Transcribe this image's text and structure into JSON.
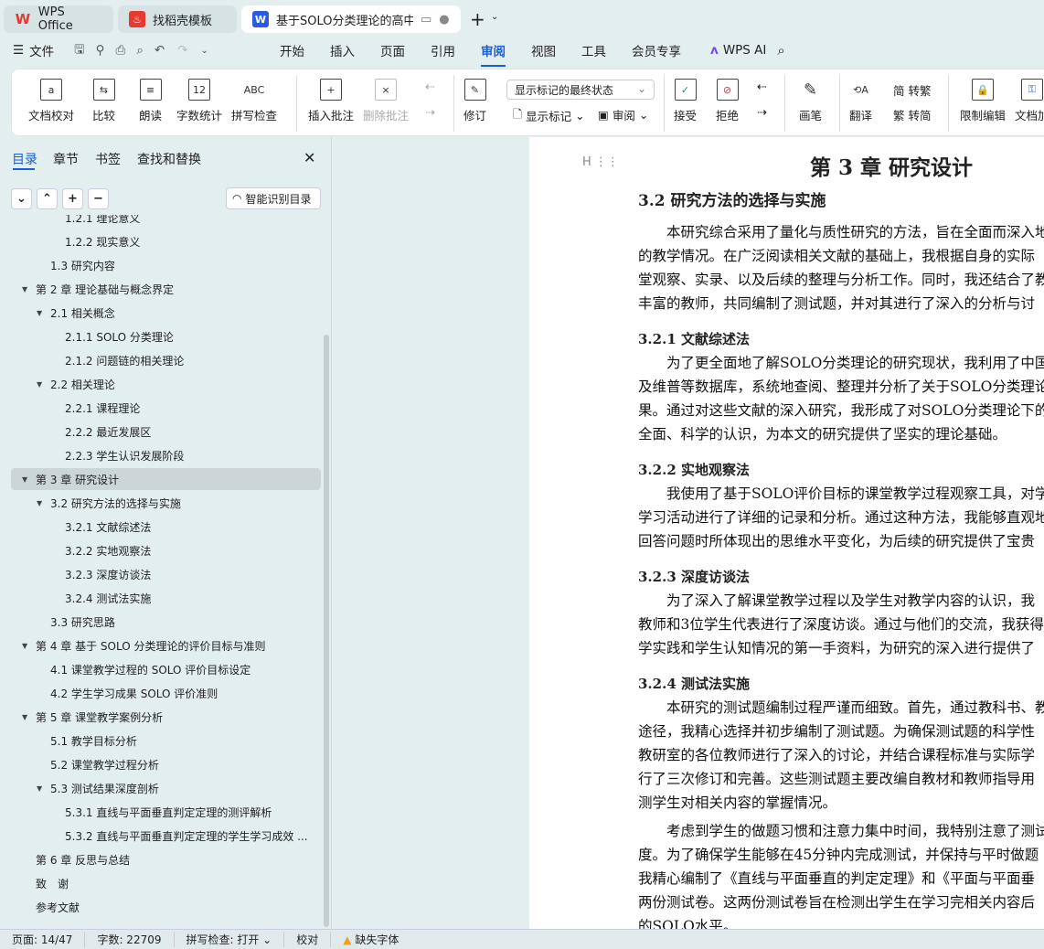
{
  "tabs": [
    {
      "label": "WPS Office"
    },
    {
      "label": "找稻壳模板"
    },
    {
      "label": "基于SOLO分类理论的高中数学"
    }
  ],
  "menu": {
    "file": "文件",
    "items": [
      "开始",
      "插入",
      "页面",
      "引用",
      "审阅",
      "视图",
      "工具",
      "会员专享"
    ],
    "active": "审阅",
    "ai": "WPS AI"
  },
  "ribbon": {
    "proof": "文档校对",
    "compare": "比较",
    "read": "朗读",
    "count": "字数统计",
    "spell": "拼写检查",
    "insert_comment": "插入批注",
    "delete_comment": "删除批注",
    "revise": "修订",
    "markup_state": "显示标记的最终状态",
    "show_markup": "显示标记",
    "review": "审阅",
    "accept": "接受",
    "reject": "拒绝",
    "pen": "画笔",
    "translate": "翻译",
    "to_trad": "转繁",
    "to_simp": "转简",
    "trad_char": "繁",
    "simp_char": "简",
    "restrict": "限制编辑",
    "doc_encrypt": "文档加"
  },
  "sidebar": {
    "tabs": [
      "目录",
      "章节",
      "书签",
      "查找和替换"
    ],
    "smart_toc": "智能识别目录",
    "toc": [
      {
        "label": "1.2.1  理论意义",
        "level": 3
      },
      {
        "label": "1.2.2  现实意义",
        "level": 3
      },
      {
        "label": "1.3  研究内容",
        "level": 2
      },
      {
        "label": "第 2 章  理论基础与概念界定",
        "level": 1,
        "expanded": true
      },
      {
        "label": "2.1  相关概念",
        "level": 2,
        "expanded": true
      },
      {
        "label": "2.1.1  SOLO 分类理论",
        "level": 3
      },
      {
        "label": "2.1.2  问题链的相关理论",
        "level": 3
      },
      {
        "label": "2.2  相关理论",
        "level": 2,
        "expanded": true
      },
      {
        "label": "2.2.1  课程理论",
        "level": 3
      },
      {
        "label": "2.2.2  最近发展区",
        "level": 3
      },
      {
        "label": "2.2.3  学生认识发展阶段",
        "level": 3
      },
      {
        "label": "第 3 章  研究设计",
        "level": 1,
        "expanded": true,
        "selected": true
      },
      {
        "label": "3.2  研究方法的选择与实施",
        "level": 2,
        "expanded": true
      },
      {
        "label": "3.2.1  文献综述法",
        "level": 3
      },
      {
        "label": "3.2.2  实地观察法",
        "level": 3
      },
      {
        "label": "3.2.3  深度访谈法",
        "level": 3
      },
      {
        "label": "3.2.4  测试法实施",
        "level": 3
      },
      {
        "label": "3.3  研究思路",
        "level": 2
      },
      {
        "label": "第 4 章  基于 SOLO 分类理论的评价目标与准则",
        "level": 1,
        "expanded": true
      },
      {
        "label": "4.1  课堂教学过程的 SOLO 评价目标设定",
        "level": 2
      },
      {
        "label": "4.2  学生学习成果 SOLO 评价准则",
        "level": 2
      },
      {
        "label": "第 5 章  课堂教学案例分析",
        "level": 1,
        "expanded": true
      },
      {
        "label": "5.1  教学目标分析",
        "level": 2
      },
      {
        "label": "5.2  课堂教学过程分析",
        "level": 2
      },
      {
        "label": "5.3  测试结果深度剖析",
        "level": 2,
        "expanded": true
      },
      {
        "label": "5.3.1  直线与平面垂直判定定理的测评解析",
        "level": 3
      },
      {
        "label": "5.3.2  直线与平面垂直判定定理的学生学习成效 ...",
        "level": 3
      },
      {
        "label": "第 6 章  反思与总结",
        "level": 1
      },
      {
        "label": "致　谢",
        "level": 1
      },
      {
        "label": "参考文献",
        "level": 1
      }
    ]
  },
  "doc": {
    "chapter": "第 3 章  研究设计",
    "section": "3.2  研究方法的选择与实施",
    "blocks": [
      {
        "type": "p",
        "lines": [
          "　　本研究综合采用了量化与质性研究的方法，旨在全面而深入地",
          "的教学情况。在广泛阅读相关文献的基础上，我根据自身的实际",
          "堂观察、实录、以及后续的整理与分析工作。同时，我还结合了教",
          "丰富的教师，共同编制了测试题，并对其进行了深入的分析与讨"
        ]
      },
      {
        "type": "h",
        "text": "3.2.1  文献综述法"
      },
      {
        "type": "p",
        "lines": [
          "　　为了更全面地了解SOLO分类理论的研究现状，我利用了中国",
          "及维普等数据库，系统地查阅、整理并分析了关于SOLO分类理论",
          "果。通过对这些文献的深入研究，我形成了对SOLO分类理论下的",
          "全面、科学的认识，为本文的研究提供了坚实的理论基础。"
        ]
      },
      {
        "type": "h",
        "text": "3.2.2  实地观察法"
      },
      {
        "type": "p",
        "lines": [
          "　　我使用了基于SOLO评价目标的课堂教学过程观察工具，对学",
          "学习活动进行了详细的记录和分析。通过这种方法，我能够直观地",
          "回答问题时所体现出的思维水平变化，为后续的研究提供了宝贵"
        ]
      },
      {
        "type": "h",
        "text": "3.2.3  深度访谈法"
      },
      {
        "type": "p",
        "lines": [
          "　　为了深入了解课堂教学过程以及学生对教学内容的认识，我",
          "教师和3位学生代表进行了深度访谈。通过与他们的交流，我获得",
          "学实践和学生认知情况的第一手资料，为研究的深入进行提供了"
        ]
      },
      {
        "type": "h",
        "text": "3.2.4  测试法实施"
      },
      {
        "type": "p",
        "lines": [
          "　　本研究的测试题编制过程严谨而细致。首先，通过教科书、教",
          "途径，我精心选择并初步编制了测试题。为确保测试题的科学性",
          "教研室的各位教师进行了深入的讨论，并结合课程标准与实际学",
          "行了三次修订和完善。这些测试题主要改编自教材和教师指导用",
          "测学生对相关内容的掌握情况。"
        ]
      },
      {
        "type": "p",
        "lines": [
          "　　考虑到学生的做题习惯和注意力集中时间，我特别注意了测试",
          "度。为了确保学生能够在45分钟内完成测试，并保持与平时做题",
          "我精心编制了《直线与平面垂直的判定定理》和《平面与平面垂",
          "两份测试卷。这两份测试卷旨在检测出学生在学习完相关内容后",
          "的SOLO水平。"
        ]
      }
    ]
  },
  "status": {
    "page": "页面: 14/47",
    "words": "字数: 22709",
    "spell": "拼写检查: 打开",
    "proof": "校对",
    "missing_font": "缺失字体"
  },
  "colors": {
    "accent": "#1a5fd6",
    "wps_red": "#e8392f"
  }
}
